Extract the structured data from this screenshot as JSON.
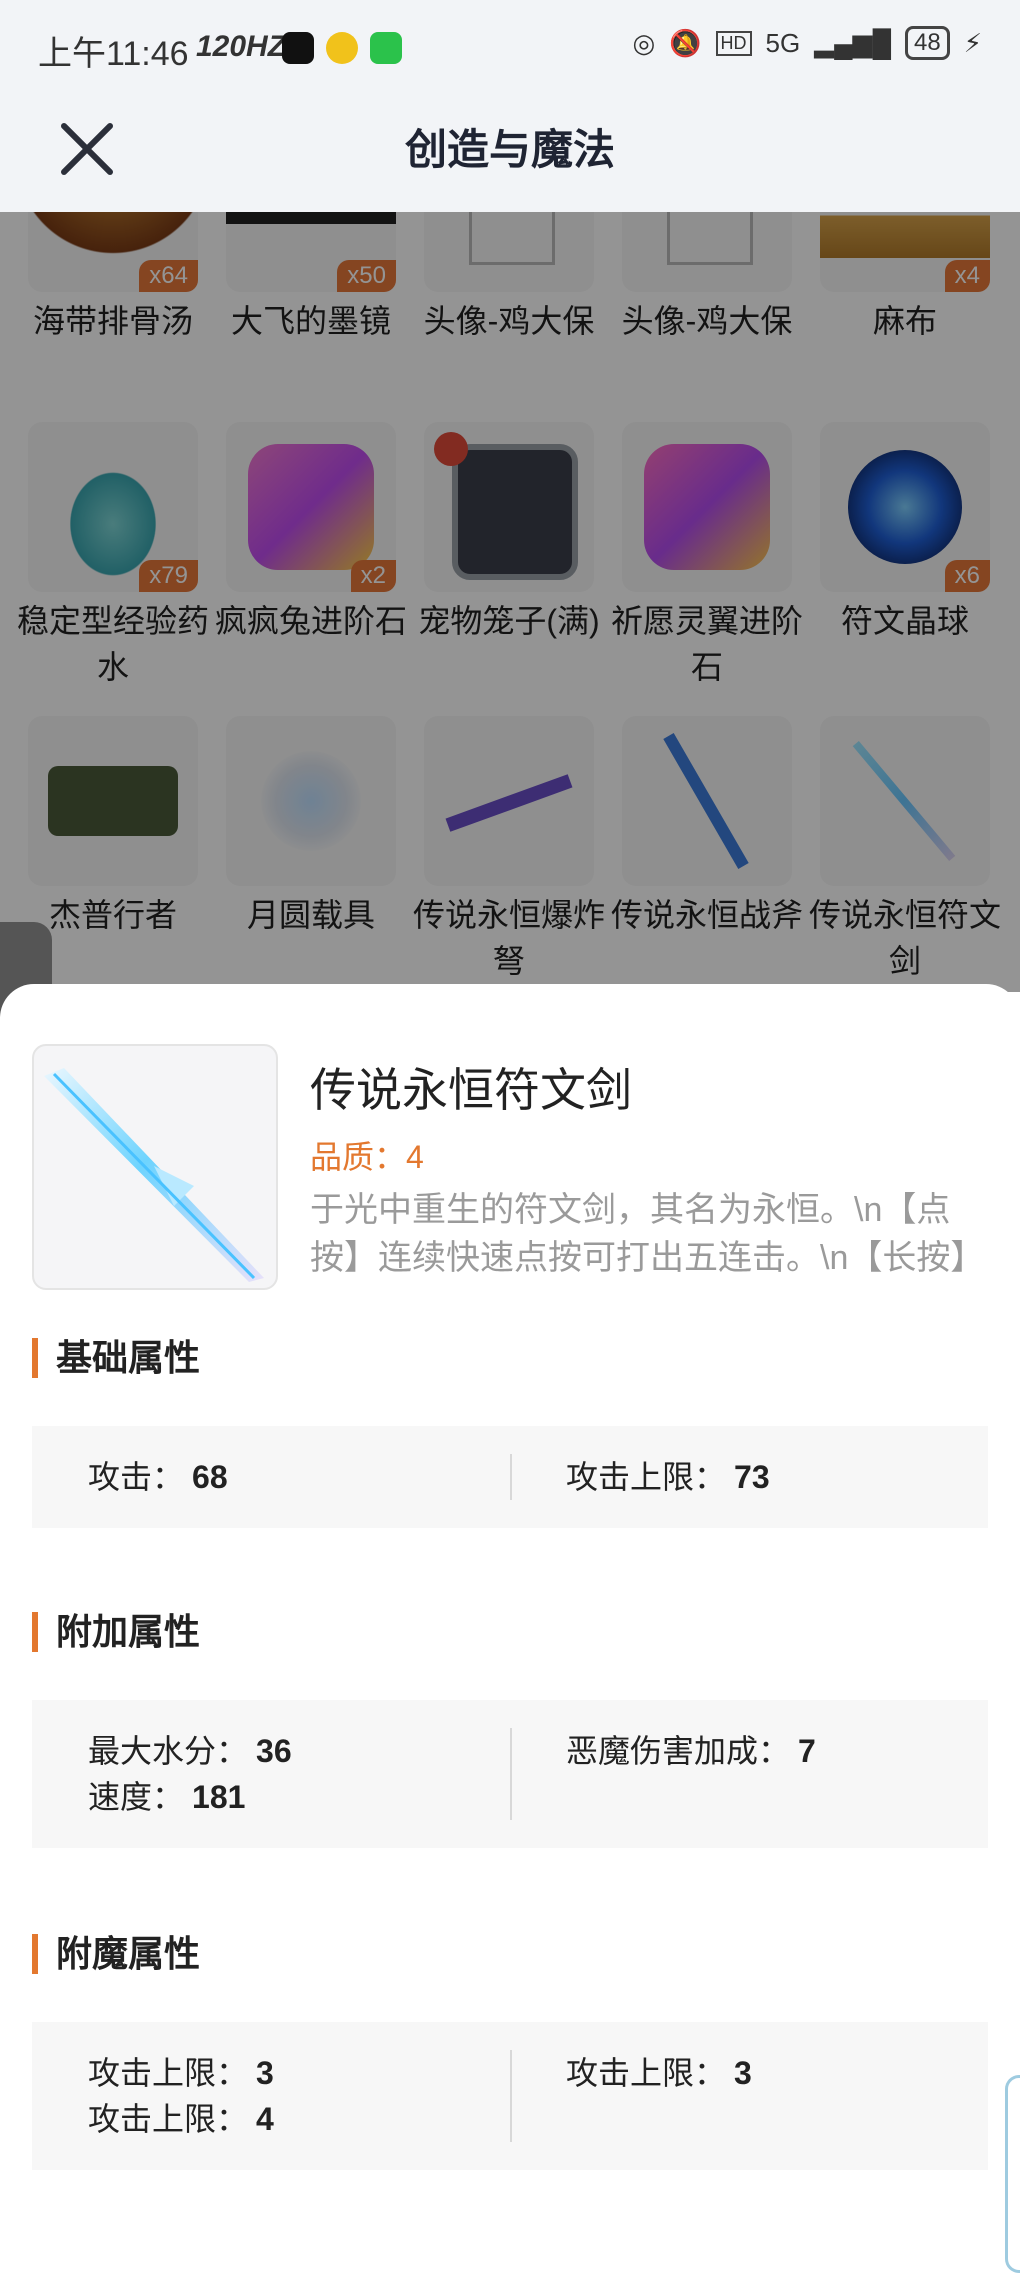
{
  "status_bar": {
    "time": "上午11:46",
    "refresh": "120HZ",
    "network": "5G",
    "battery": "48"
  },
  "header": {
    "title": "创造与魔法"
  },
  "grid": {
    "row1": [
      {
        "name": "海带排骨汤",
        "count": "x64"
      },
      {
        "name": "大飞的墨镜",
        "count": "x50"
      },
      {
        "name": "头像-鸡大保",
        "count": ""
      },
      {
        "name": "头像-鸡大保",
        "count": ""
      },
      {
        "name": "麻布",
        "count": "x4"
      }
    ],
    "row2": [
      {
        "name": "稳定型经验药水",
        "count": "x79"
      },
      {
        "name": "疯疯兔进阶石",
        "count": "x2"
      },
      {
        "name": "宠物笼子(满)",
        "count": ""
      },
      {
        "name": "祈愿灵翼进阶石",
        "count": ""
      },
      {
        "name": "符文晶球",
        "count": "x6"
      }
    ],
    "row3": [
      {
        "name": "杰普行者",
        "count": ""
      },
      {
        "name": "月圆载具",
        "count": ""
      },
      {
        "name": "传说永恒爆炸弩",
        "count": ""
      },
      {
        "name": "传说永恒战斧",
        "count": ""
      },
      {
        "name": "传说永恒符文剑",
        "count": ""
      }
    ]
  },
  "detail": {
    "name": "传说永恒符文剑",
    "quality": "品质：4",
    "description": "于光中重生的符文剑，其名为永恒。\\n【点按】连续快速点按可打出五连击。\\n【长按】"
  },
  "sections": {
    "base": {
      "title": "基础属性",
      "left": [
        {
          "label": "攻击：",
          "value": "68"
        }
      ],
      "right": [
        {
          "label": "攻击上限：",
          "value": "73"
        }
      ]
    },
    "extra": {
      "title": "附加属性",
      "left": [
        {
          "label": "最大水分：",
          "value": "36"
        },
        {
          "label": "速度：",
          "value": "181"
        }
      ],
      "right": [
        {
          "label": "恶魔伤害加成：",
          "value": "7"
        }
      ]
    },
    "enchant": {
      "title": "附魔属性",
      "left": [
        {
          "label": "攻击上限：",
          "value": "3"
        },
        {
          "label": "攻击上限：",
          "value": "4"
        }
      ],
      "right": [
        {
          "label": "攻击上限：",
          "value": "3"
        }
      ]
    }
  }
}
